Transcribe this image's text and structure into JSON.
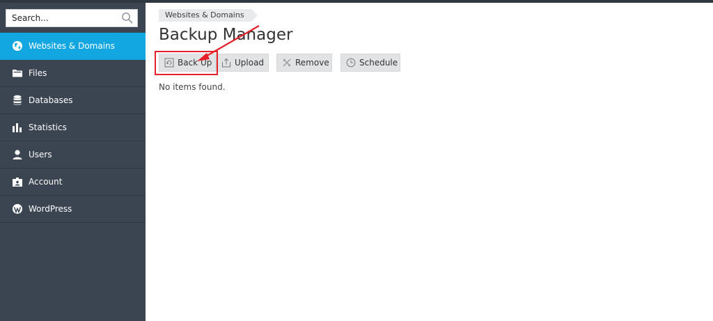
{
  "sidebar": {
    "search": {
      "placeholder": "Search..."
    },
    "items": [
      {
        "label": "Websites & Domains",
        "icon": "globe-icon",
        "active": true
      },
      {
        "label": "Files",
        "icon": "folder-icon",
        "active": false
      },
      {
        "label": "Databases",
        "icon": "database-icon",
        "active": false
      },
      {
        "label": "Statistics",
        "icon": "bar-chart-icon",
        "active": false
      },
      {
        "label": "Users",
        "icon": "user-icon",
        "active": false
      },
      {
        "label": "Account",
        "icon": "account-card-icon",
        "active": false
      },
      {
        "label": "WordPress",
        "icon": "wordpress-icon",
        "active": false
      }
    ]
  },
  "main": {
    "breadcrumb": "Websites & Domains",
    "title": "Backup Manager",
    "toolbar": {
      "backup": "Back Up",
      "upload": "Upload",
      "remove": "Remove",
      "schedule": "Schedule"
    },
    "empty_message": "No items found."
  },
  "colors": {
    "sidebar_bg": "#3a4551",
    "active_item": "#12a7e0",
    "annotation": "#e5202a"
  }
}
